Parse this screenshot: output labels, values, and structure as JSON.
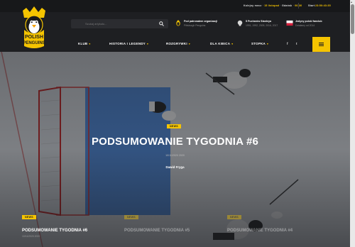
{
  "topbar": {
    "next_label": "Kolejny mecz",
    "next_sep": " · ",
    "next_date": "15 listopad",
    "next_team": "Gdańsk",
    "next_time": "06:30",
    "countdown_label": "Start",
    "countdown": "23:50:43:35"
  },
  "logo": {
    "text_top": "POLISH",
    "text_bottom": "PENGUINS"
  },
  "search": {
    "placeholder": "Szukaj artykułu..."
  },
  "header_info": [
    {
      "title": "Pod patronatem organizacji",
      "sub": "Pittsburgh Penguins",
      "icon": "penguin-icon"
    },
    {
      "title": "5 Pucharów Stanleya",
      "sub": "1991, 1992, 2009, 2016, 2017",
      "icon": "trophy-icon"
    },
    {
      "title": "Jedyny polski fanclub",
      "sub": "Działamy od 2014",
      "icon": "poland-flag-icon"
    }
  ],
  "nav": {
    "items": [
      {
        "label": "KLUB",
        "caret": "▾"
      },
      {
        "label": "HISTORIA I LEGENDY",
        "caret": "▾"
      },
      {
        "label": "ROZGRYWKI",
        "caret": "▾"
      },
      {
        "label": "DLA KIBICA",
        "caret": "▾"
      },
      {
        "label": "STOPKA",
        "caret": "▾"
      }
    ],
    "social": [
      "f",
      "t"
    ]
  },
  "hero": {
    "category": "NEWS",
    "title": "PODSUMOWANIE TYGODNIA #6",
    "date": "10/11/2020 2020",
    "author": "Dawid Fryga"
  },
  "cards": [
    {
      "category": "NEWS",
      "title": "PODSUMOWANIE TYGODNIA #6",
      "date": "10/11/2020 2020"
    },
    {
      "category": "NEWS",
      "title": "PODSUMOWANIE TYGODNIA #5",
      "date": ""
    },
    {
      "category": "NEWS",
      "title": "PODSUMOWANIE TYGODNIA #4",
      "date": ""
    }
  ],
  "colors": {
    "accent": "#f5c400",
    "bg": "#1e1f22",
    "crease": "#3a78c8",
    "goal": "#c8302c"
  }
}
